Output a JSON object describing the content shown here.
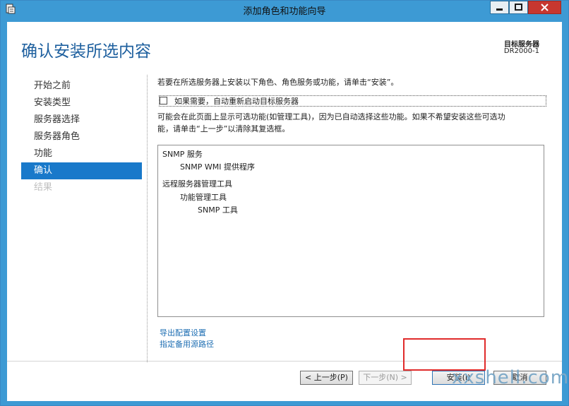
{
  "window": {
    "title": "添加角色和功能向导",
    "app_icon": "wizard-app-icon",
    "controls": [
      "minimize-icon",
      "maximize-icon",
      "close-icon"
    ],
    "accent": "#3d9ad4"
  },
  "header": {
    "title": "确认安装所选内容",
    "server_label": "目标服务器",
    "server_name": "DR2000-1"
  },
  "nav": {
    "items": [
      {
        "label": "开始之前",
        "state": "normal"
      },
      {
        "label": "安装类型",
        "state": "normal"
      },
      {
        "label": "服务器选择",
        "state": "normal"
      },
      {
        "label": "服务器角色",
        "state": "normal"
      },
      {
        "label": "功能",
        "state": "normal"
      },
      {
        "label": "确认",
        "state": "selected"
      },
      {
        "label": "结果",
        "state": "disabled"
      }
    ],
    "selected_color": "#1979ca"
  },
  "main": {
    "intro": "若要在所选服务器上安装以下角色、角色服务或功能，请单击“安装”。",
    "restart_checkbox_label": "如果需要，自动重新启动目标服务器",
    "restart_checked": false,
    "note_line1": "可能会在此页面上显示可选功能(如管理工具)，因为已自动选择这些功能。如果不希望安装这些可选功",
    "note_line2": "能，请单击“上一步”以清除其复选框。",
    "features": [
      {
        "text": "SNMP 服务",
        "level": 0
      },
      {
        "text": "SNMP WMI 提供程序",
        "level": 1
      },
      {
        "text": "远程服务器管理工具",
        "level": 0
      },
      {
        "text": "功能管理工具",
        "level": 1
      },
      {
        "text": "SNMP 工具",
        "level": 2
      }
    ],
    "export_link": "导出配置设置",
    "source_link": "指定备用源路径"
  },
  "footer": {
    "prev_label": "< 上一步(P)",
    "next_label": "下一步(N) >",
    "install_label": "安装(I)",
    "cancel_label": "取消",
    "highlight_color": "#e02b2b"
  },
  "watermark": "xxshell.com"
}
